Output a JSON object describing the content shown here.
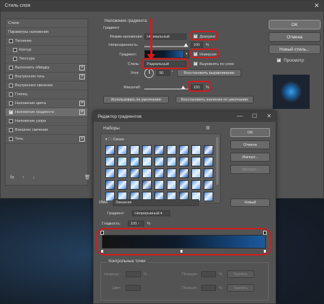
{
  "layer_style": {
    "title": "Стиль слоя",
    "list_header": "Стили",
    "list_items": [
      {
        "label": "Параметры наложения",
        "checkbox": false,
        "plus": false,
        "header": true,
        "selected": false
      },
      {
        "label": "Тиснение",
        "checkbox": true,
        "checked": false,
        "plus": false
      },
      {
        "label": "Контур",
        "checkbox": true,
        "checked": false,
        "plus": false,
        "sub": true
      },
      {
        "label": "Текстура",
        "checkbox": true,
        "checked": false,
        "plus": false,
        "sub": true
      },
      {
        "label": "Выполнить обводку",
        "checkbox": true,
        "checked": false,
        "plus": true
      },
      {
        "label": "Внутренняя тень",
        "checkbox": true,
        "checked": false,
        "plus": true
      },
      {
        "label": "Внутреннее свечение",
        "checkbox": true,
        "checked": false,
        "plus": false
      },
      {
        "label": "Глянец",
        "checkbox": true,
        "checked": false,
        "plus": false
      },
      {
        "label": "Наложение цвета",
        "checkbox": true,
        "checked": false,
        "plus": true
      },
      {
        "label": "Наложение градиента",
        "checkbox": true,
        "checked": true,
        "plus": true,
        "selected": true
      },
      {
        "label": "Наложение узора",
        "checkbox": true,
        "checked": false,
        "plus": false
      },
      {
        "label": "Внешнее свечение",
        "checkbox": true,
        "checked": false,
        "plus": false
      },
      {
        "label": "Тень",
        "checkbox": true,
        "checked": false,
        "plus": true
      }
    ],
    "footer_icons": [
      "fx",
      "↑",
      "↓",
      "🗑"
    ],
    "panel": {
      "section_title": "Наложение градиента",
      "group_title": "Градиент",
      "blend_label": "Режим наложения:",
      "blend_value": "Нормальный",
      "dither_label": "Дизеринг",
      "opacity_label": "Непрозрачность:",
      "opacity_value": "100",
      "percent": "%",
      "gradient_label": "Градиент:",
      "reverse_label": "Инверсия",
      "style_label": "Стиль:",
      "style_value": "Радиальный",
      "align_label": "Выровнять по слою",
      "angle_label": "Угол:",
      "angle_value": "90",
      "reset_align_button": "Восстановить выравнивание",
      "scale_label": "Масштаб:",
      "scale_value": "150",
      "default_button": "Использовать по умолчанию",
      "restore_default_button": "Восстановить значения по умолчанию"
    },
    "right_buttons": {
      "ok": "OK",
      "cancel": "Отмена",
      "new_style": "Новый стиль...",
      "preview_label": "Просмотр"
    }
  },
  "gradient_editor": {
    "title": "Редактор градиентов",
    "presets_label": "Наборы",
    "gear_icon": "⚙",
    "folder_name": "Синие",
    "ok": "OK",
    "cancel": "Отмена",
    "import": "Импорт...",
    "export": "Экспорт...",
    "name_label": "Имя:",
    "name_value": "Заказная",
    "new_button": "Новый",
    "type_label": "Градиент:",
    "type_value": "Непрерывный",
    "smooth_label": "Гладкость:",
    "smooth_value": "100",
    "percent": "%",
    "control_points_title": "Контрольные точки",
    "opacity_label": "Непрозр.:",
    "position_label": "Позиция:",
    "delete_label": "Удалить",
    "color_label": "Цвет:",
    "position_label2": "Позиция:",
    "delete_label2": "Удалить",
    "swatch_colors": [
      [
        "#2f6fd6",
        "#5b8fe6",
        "#8fb5ee",
        "#4a90e2",
        "#1e5fc2",
        "#79a9f0",
        "#3c7ad8",
        "#a5c3f2",
        "#2a57b8"
      ],
      [
        "#4aa3f0",
        "#70c0f6",
        "#1d88e6",
        "#92d2fa",
        "#3b95e8",
        "#5aaaf2",
        "#1a6cd0",
        "#86baf4",
        "#2e7ee0"
      ],
      [
        "#3a7dd8",
        "#5fa0ee",
        "#0e5cb8",
        "#7ab6f4",
        "#2c6ccc",
        "#4f94e8",
        "#1a4fa8",
        "#98c6f6",
        "#3e88e0"
      ],
      [
        "#1b5fc4",
        "#3c86e2",
        "#6aaaf2",
        "#244d96",
        "#4c8ee0",
        "#7fb4f2",
        "#1e68c8",
        "#5698e6",
        "#2b5fae"
      ],
      [
        "#3a8ee8",
        "#5ea8f0",
        "#2170cc",
        "#86c0f6",
        "#3a78d4",
        "#62a2ec",
        "#1c5cb4",
        "#9ccaf6",
        "#4a8ee2"
      ]
    ]
  },
  "colors": {
    "accent_red": "#d7191c",
    "dialog_bg": "#535353",
    "titlebar_bg": "#3f3f3f"
  }
}
